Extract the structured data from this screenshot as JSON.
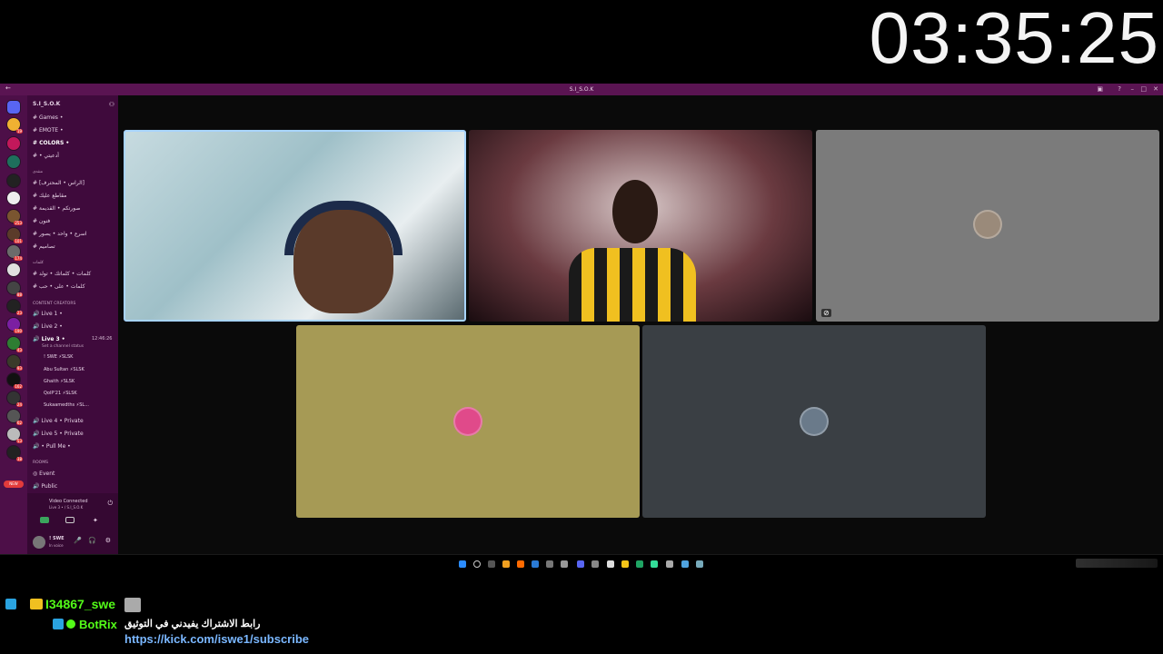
{
  "stream_timer": "03:35:25",
  "window": {
    "title": "S.I_S.O.K"
  },
  "server": {
    "name": "S.I_S.O.K"
  },
  "channels": [
    {
      "label": "Games •"
    },
    {
      "label": "EMOTE •"
    },
    {
      "label": "COLORS •"
    },
    {
      "label": "• أدعيتي"
    }
  ],
  "category_ar": "منتدى",
  "text_channels": [
    "[الراس • المحترف]",
    "مقاطع عليك",
    "صورتكم • القديمة",
    "فنون",
    "اسرع • واحد • يصور",
    "تصاميم"
  ],
  "category2": "كلمات",
  "text_channels2": [
    "كلمات • كلماتك • تولد",
    "كلمات • على • حب"
  ],
  "content_creators": "CONTENT CREATORS",
  "voice": {
    "live1": "Live 1 •",
    "live2": "Live 2 •",
    "live3": "Live 3 •",
    "live3_time": "12:46:26",
    "status_hint": "Set a channel status",
    "members": [
      "! SWE",
      "Abu Sultan",
      "Ghaith",
      "QolP'21",
      "Sukaamedths"
    ],
    "member_tags": [
      "SLSK",
      "SLSK",
      "SLSK",
      "SLSK",
      "SL..."
    ],
    "live4": "Live 4 • Private",
    "live5": "Live 5 • Private",
    "pullme": "• Pull Me •",
    "rooms": "ROOMS",
    "event": "Event",
    "public": "Public"
  },
  "connection": {
    "status": "Video Connected",
    "location": "Live 3 • / S.I_S.O.K"
  },
  "user": {
    "name": "! SWE",
    "status": "In voice"
  },
  "rail_badges": [
    "19",
    "253",
    "101",
    "174",
    "88",
    "23",
    "190",
    "43",
    "93",
    "162",
    "24",
    "62",
    "53",
    "38",
    "NEW"
  ],
  "tiles": {
    "colors": [
      "#8fb8c2",
      "#3a1c20",
      "#7b7b7b",
      "#a69a55",
      "#3a3f44"
    ]
  },
  "chat": [
    {
      "user": "I34867_swe",
      "text": ""
    },
    {
      "user": "BotRix",
      "text": "رابط الاشتراك يفيدني في التوثيق",
      "link": "https://kick.com/iswe1/subscribe"
    }
  ]
}
